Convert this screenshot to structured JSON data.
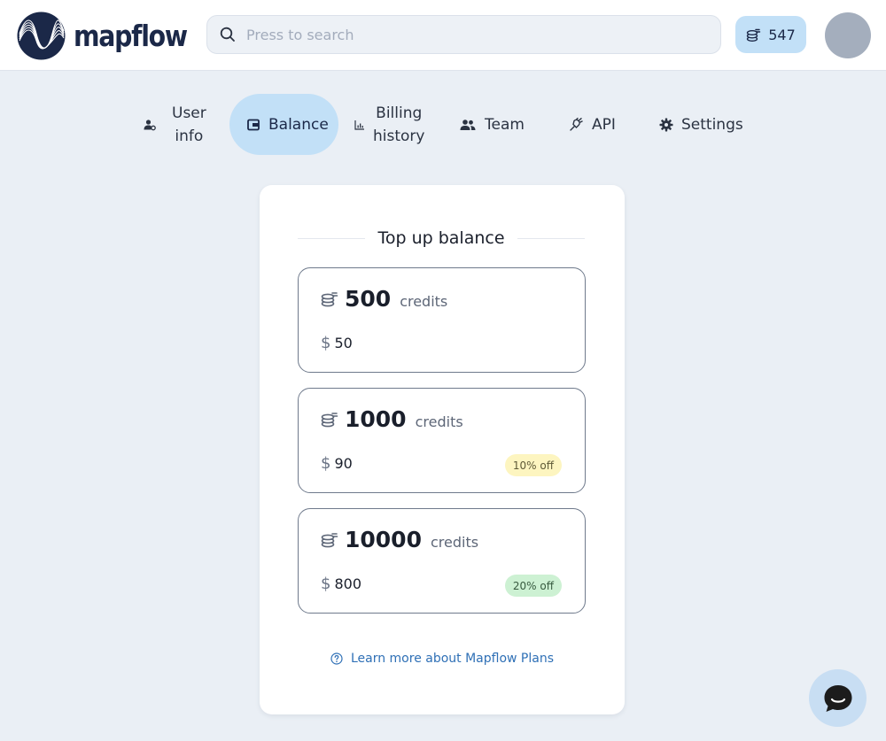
{
  "app": {
    "brand": "mapflow"
  },
  "header": {
    "search_placeholder": "Press to search",
    "credits_balance": "547"
  },
  "tabs": [
    {
      "id": "user-info",
      "label_line1": "User",
      "label_line2": "info",
      "icon": "user-gear-icon",
      "active": false
    },
    {
      "id": "balance",
      "label": "Balance",
      "icon": "wallet-icon",
      "active": true
    },
    {
      "id": "billing-history",
      "label_line1": "Billing",
      "label_line2": "history",
      "icon": "bar-chart-icon",
      "active": false
    },
    {
      "id": "team",
      "label": "Team",
      "icon": "users-icon",
      "active": false
    },
    {
      "id": "api",
      "label": "API",
      "icon": "plug-icon",
      "active": false
    },
    {
      "id": "settings",
      "label": "Settings",
      "icon": "gear-icon",
      "active": false
    }
  ],
  "topup": {
    "title": "Top up balance",
    "plans": [
      {
        "credits": "500",
        "unit": "credits",
        "currency": "$",
        "price": "50",
        "discount": null
      },
      {
        "credits": "1000",
        "unit": "credits",
        "currency": "$",
        "price": "90",
        "discount": "10% off"
      },
      {
        "credits": "10000",
        "unit": "credits",
        "currency": "$",
        "price": "800",
        "discount": "20% off"
      }
    ],
    "learn_more": "Learn more about Mapflow Plans"
  },
  "colors": {
    "accent": "#c2e0f7",
    "link": "#2f70b6",
    "badge_yellow": "#fdf5c0",
    "badge_green": "#cdf1d3",
    "background": "#eaeff5"
  }
}
